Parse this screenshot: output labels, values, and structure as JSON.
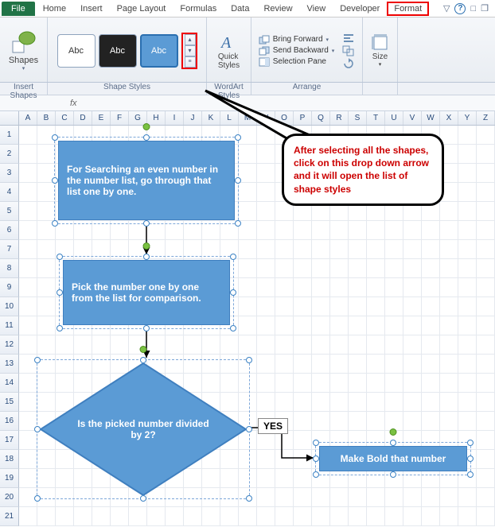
{
  "tabs": {
    "file": "File",
    "home": "Home",
    "insert": "Insert",
    "page_layout": "Page Layout",
    "formulas": "Formulas",
    "data": "Data",
    "review": "Review",
    "view": "View",
    "developer": "Developer",
    "format": "Format"
  },
  "ribbon": {
    "shapes": "Shapes",
    "abc": "Abc",
    "quick_styles": "Quick\nStyles",
    "bring_forward": "Bring Forward",
    "send_backward": "Send Backward",
    "selection_pane": "Selection Pane",
    "size": "Size",
    "groups": {
      "insert_shapes": "Insert Shapes",
      "shape_styles": "Shape Styles",
      "wordart": "WordArt Styles",
      "arrange": "Arrange"
    }
  },
  "fx": {
    "label": "fx"
  },
  "cols": [
    "A",
    "B",
    "C",
    "D",
    "E",
    "F",
    "G",
    "H",
    "I",
    "J",
    "K",
    "L",
    "M",
    "N",
    "O",
    "P",
    "Q",
    "R",
    "S",
    "T",
    "U",
    "V",
    "W",
    "X",
    "Y",
    "Z"
  ],
  "rows": [
    "1",
    "2",
    "3",
    "4",
    "5",
    "6",
    "7",
    "8",
    "9",
    "10",
    "11",
    "12",
    "13",
    "14",
    "15",
    "16",
    "17",
    "18",
    "19",
    "20",
    "21"
  ],
  "shapes": {
    "s1": "For Searching an even number in the number list, go through that list one by one.",
    "s2": "Pick the number one by one from the list for comparison.",
    "s3": "Is the picked number divided  by 2?",
    "yes": "YES",
    "s4": "Make Bold that number"
  },
  "callout": "After selecting all the shapes, click on this drop down  arrow and it will open the list of shape styles"
}
